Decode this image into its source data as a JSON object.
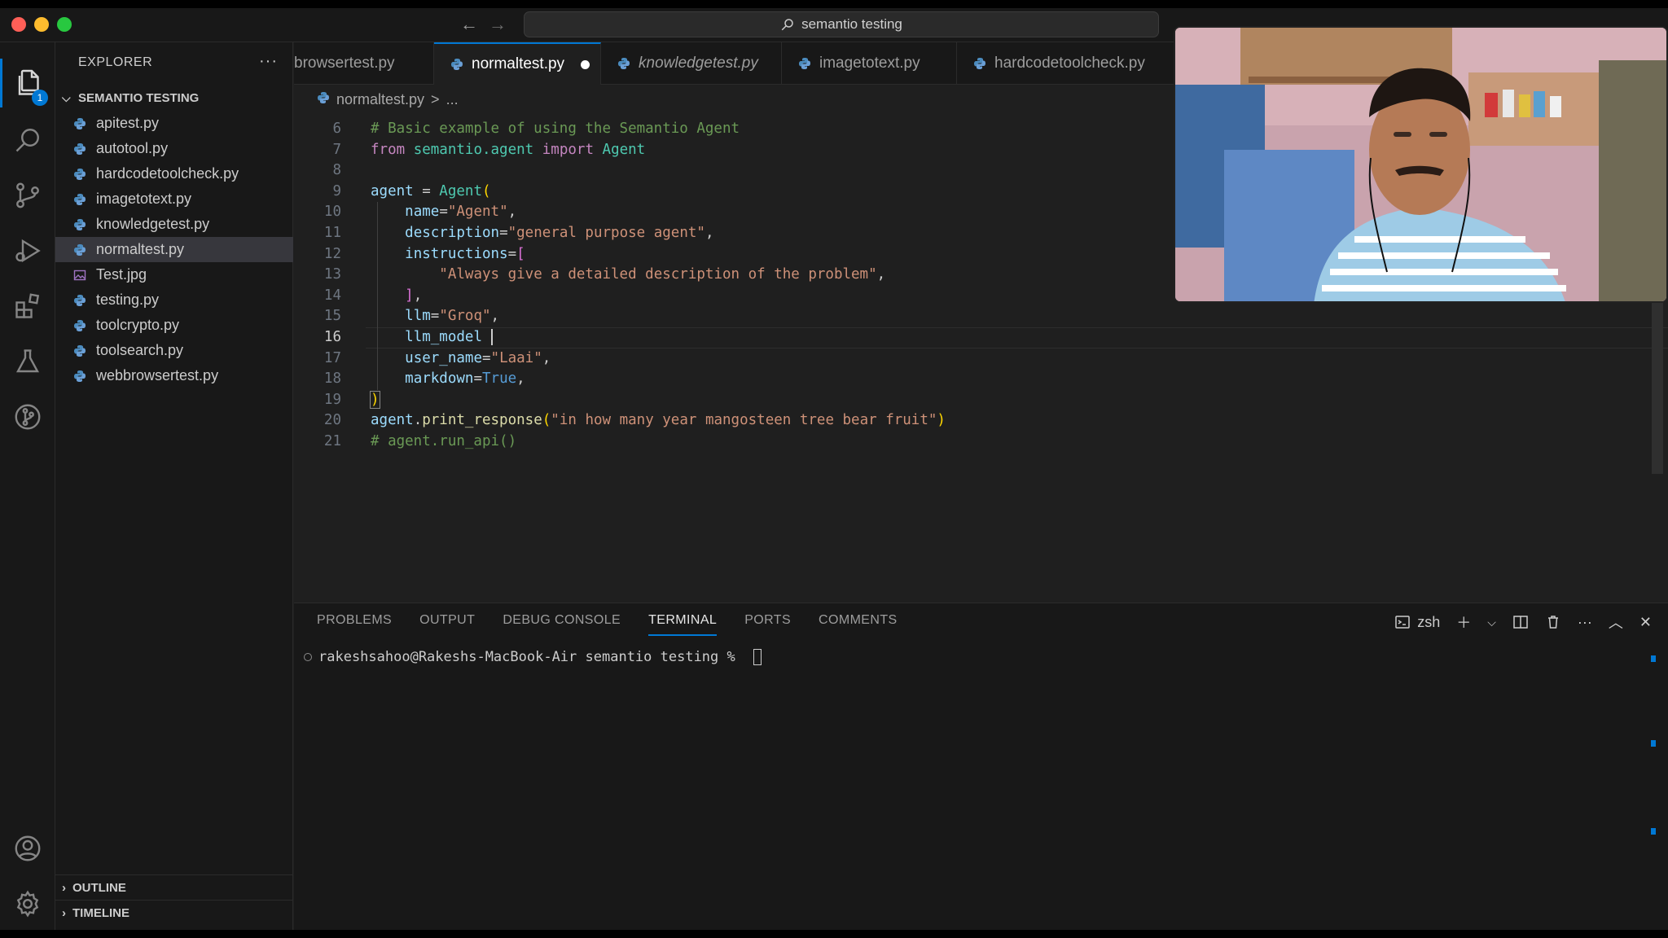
{
  "window": {
    "command_center": "semantio testing"
  },
  "activity": {
    "explorer_badge": "1"
  },
  "sidebar": {
    "header": "EXPLORER",
    "more": "···",
    "folder": "SEMANTIO TESTING",
    "files": [
      {
        "name": "apitest.py",
        "type": "python"
      },
      {
        "name": "autotool.py",
        "type": "python"
      },
      {
        "name": "hardcodetoolcheck.py",
        "type": "python"
      },
      {
        "name": "imagetotext.py",
        "type": "python"
      },
      {
        "name": "knowledgetest.py",
        "type": "python"
      },
      {
        "name": "normaltest.py",
        "type": "python",
        "active": true
      },
      {
        "name": "Test.jpg",
        "type": "image"
      },
      {
        "name": "testing.py",
        "type": "python"
      },
      {
        "name": "toolcrypto.py",
        "type": "python"
      },
      {
        "name": "toolsearch.py",
        "type": "python"
      },
      {
        "name": "webbrowsertest.py",
        "type": "python"
      }
    ],
    "outline": "OUTLINE",
    "timeline": "TIMELINE"
  },
  "tabs": [
    {
      "label": "browsertest.py"
    },
    {
      "label": "normaltest.py"
    },
    {
      "label": "knowledgetest.py"
    },
    {
      "label": "imagetotext.py"
    },
    {
      "label": "hardcodetoolcheck.py"
    }
  ],
  "breadcrumbs": {
    "file": "normaltest.py",
    "sep": ">",
    "rest": "..."
  },
  "editor": {
    "current_line": 16,
    "lines": [
      {
        "n": "6"
      },
      {
        "n": "7"
      },
      {
        "n": "8"
      },
      {
        "n": "9"
      },
      {
        "n": "10"
      },
      {
        "n": "11"
      },
      {
        "n": "12"
      },
      {
        "n": "13"
      },
      {
        "n": "14"
      },
      {
        "n": "15"
      },
      {
        "n": "16"
      },
      {
        "n": "17"
      },
      {
        "n": "18"
      },
      {
        "n": "19"
      },
      {
        "n": "20"
      },
      {
        "n": "21"
      }
    ],
    "code": {
      "l6": "# Basic example of using the Semantio Agent",
      "l7_from": "from",
      "l7_mod": "semantio.agent",
      "l7_import": "import",
      "l7_name": "Agent",
      "l9_var": "agent",
      "l9_eq": " = ",
      "l9_cls": "Agent",
      "l9_open": "(",
      "l10_param": "name",
      "l10_val": "\"Agent\"",
      "l11_param": "description",
      "l11_val": "\"general purpose agent\"",
      "l12_param": "instructions",
      "l12_open": "[",
      "l13_val": "\"Always give a detailed description of the problem\"",
      "l14_close": "]",
      "l15_param": "llm",
      "l15_val": "\"Groq\"",
      "l16_text": "llm_model ",
      "l17_param": "user_name",
      "l17_val": "\"Laai\"",
      "l18_param": "markdown",
      "l18_val": "True",
      "l19_close": ")",
      "l20_obj": "agent",
      "l20_fn": "print_response",
      "l20_val": "\"in how many year mangosteen tree bear fruit\"",
      "l21": "# agent.run_api()"
    }
  },
  "panel": {
    "tabs": [
      "PROBLEMS",
      "OUTPUT",
      "DEBUG CONSOLE",
      "TERMINAL",
      "PORTS",
      "COMMENTS"
    ],
    "active_tab": "TERMINAL",
    "shell": "zsh",
    "prompt": "rakeshsahoo@Rakeshs-MacBook-Air semantio testing % "
  },
  "colors": {
    "accent": "#0078d4",
    "editor_bg": "#1f1f1f",
    "sidebar_bg": "#181818",
    "comment": "#6a9955",
    "keyword": "#c586c0",
    "string": "#ce9178",
    "param": "#9cdcfe"
  },
  "icons": [
    "files-icon",
    "search-icon",
    "source-control-icon",
    "run-debug-icon",
    "extensions-icon",
    "testing-icon",
    "git-graph-icon",
    "account-icon",
    "settings-gear-icon",
    "python-file-icon",
    "image-file-icon"
  ]
}
